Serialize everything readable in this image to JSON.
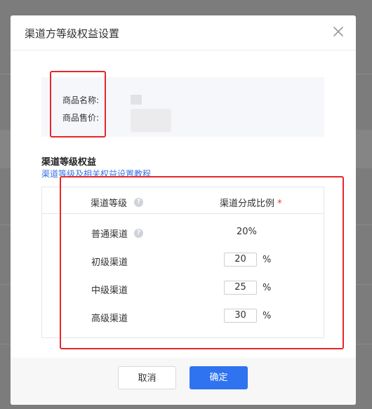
{
  "dialog": {
    "title": "渠道方等级权益设置",
    "close_icon": "close-icon"
  },
  "product": {
    "name_label": "商品名称:",
    "price_label": "商品售价:"
  },
  "section": {
    "title": "渠道等级权益",
    "tutorial_link": "渠道等级及相关权益设置教程"
  },
  "table": {
    "headers": {
      "level": "渠道等级",
      "ratio": "渠道分成比例",
      "required_mark": "*"
    },
    "help_icon": "question-circle-icon",
    "rows": [
      {
        "label": "普通渠道",
        "value": "20%"
      },
      {
        "label": "初级渠道",
        "value": "20",
        "unit": "%"
      },
      {
        "label": "中级渠道",
        "value": "25",
        "unit": "%"
      },
      {
        "label": "高级渠道",
        "value": "30",
        "unit": "%"
      }
    ]
  },
  "footer": {
    "cancel_label": "取消",
    "confirm_label": "确定"
  },
  "colors": {
    "primary": "#2f73f0",
    "highlight_red": "#e8262a",
    "link": "#3a73e0"
  }
}
